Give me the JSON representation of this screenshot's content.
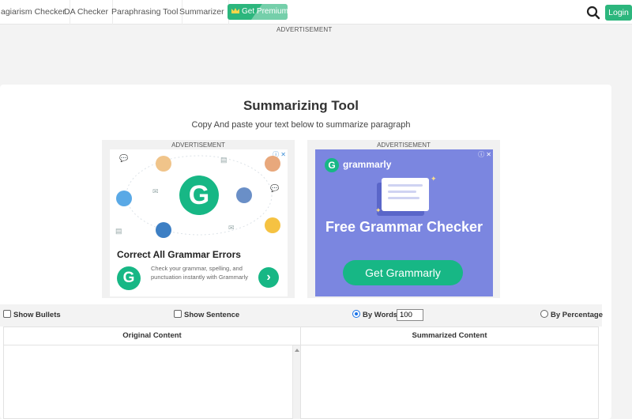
{
  "nav": {
    "items": [
      "agiarism Checker",
      "DA Checker",
      "Paraphrasing Tool",
      "Summarizer"
    ],
    "premium_label": "Get Premium",
    "login_label": "Login"
  },
  "ads": {
    "top_label": "ADVERTISEMENT",
    "left": {
      "label": "ADVERTISEMENT",
      "headline": "Correct All Grammar Errors",
      "body": "Check your grammar, spelling, and punctuation instantly with Grammarly"
    },
    "right": {
      "label": "ADVERTISEMENT",
      "brand": "grammarly",
      "headline": "Free Grammar Checker",
      "cta": "Get Grammarly"
    }
  },
  "main": {
    "title": "Summarizing Tool",
    "subtitle": "Copy And paste your text below to summarize paragraph"
  },
  "options": {
    "show_bullets": "Show Bullets",
    "show_sentence": "Show Sentence",
    "by_words": "By Words",
    "words_value": "100",
    "by_percentage": "By Percentage"
  },
  "panels": {
    "original": "Original Content",
    "summarized": "Summarized Content"
  },
  "colors": {
    "brand_green": "#2cb67d",
    "grammarly_green": "#17b785",
    "ad_purple": "#7b86e0"
  }
}
